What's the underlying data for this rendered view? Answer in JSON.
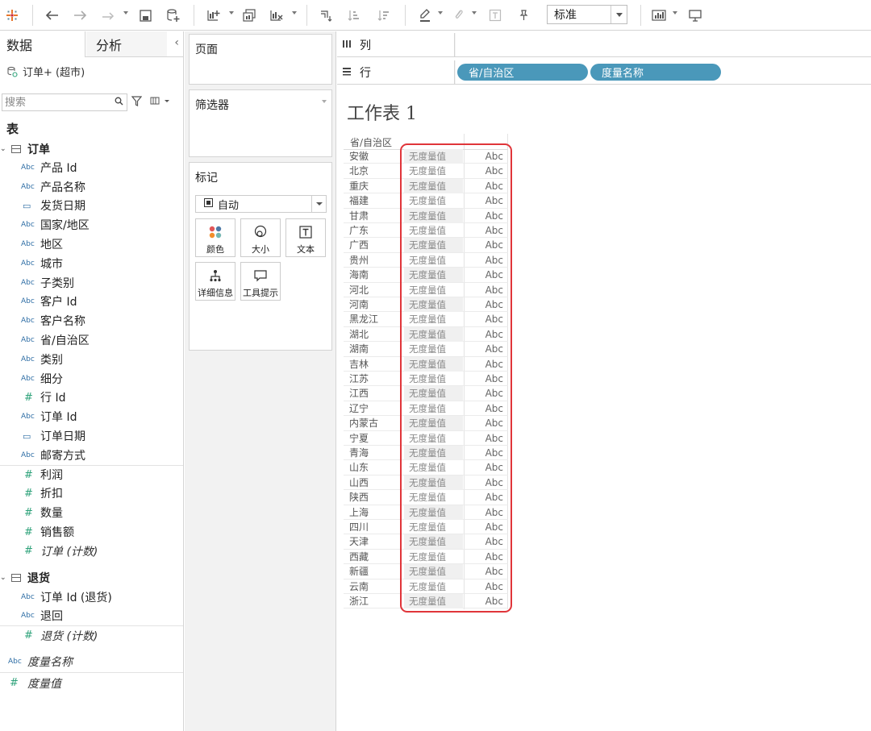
{
  "toolbar": {
    "view_size": "标准"
  },
  "left_pane": {
    "tabs": {
      "data": "数据",
      "analytics": "分析"
    },
    "datasource": "订单+ (超市)",
    "search_placeholder": "搜索",
    "tables_heading": "表",
    "tables": [
      {
        "name": "订单",
        "fields": [
          {
            "type": "Abc",
            "name": "产品 Id"
          },
          {
            "type": "Abc",
            "name": "产品名称"
          },
          {
            "type": "date",
            "name": "发货日期"
          },
          {
            "type": "Abc",
            "name": "国家/地区"
          },
          {
            "type": "Abc",
            "name": "地区"
          },
          {
            "type": "Abc",
            "name": "城市"
          },
          {
            "type": "Abc",
            "name": "子类别"
          },
          {
            "type": "Abc",
            "name": "客户 Id"
          },
          {
            "type": "Abc",
            "name": "客户名称"
          },
          {
            "type": "Abc",
            "name": "省/自治区"
          },
          {
            "type": "Abc",
            "name": "类别"
          },
          {
            "type": "Abc",
            "name": "细分"
          },
          {
            "type": "#",
            "name": "行 Id"
          },
          {
            "type": "Abc",
            "name": "订单 Id"
          },
          {
            "type": "date",
            "name": "订单日期"
          },
          {
            "type": "Abc",
            "name": "邮寄方式"
          }
        ],
        "measures": [
          {
            "type": "#",
            "name": "利润"
          },
          {
            "type": "#",
            "name": "折扣"
          },
          {
            "type": "#",
            "name": "数量"
          },
          {
            "type": "#",
            "name": "销售额"
          },
          {
            "type": "#",
            "name": "订单 (计数)",
            "italic": true
          }
        ]
      },
      {
        "name": "退货",
        "fields": [
          {
            "type": "Abc",
            "name": "订单 Id (退货)"
          },
          {
            "type": "Abc",
            "name": "退回"
          }
        ],
        "measures": [
          {
            "type": "#",
            "name": "退货 (计数)",
            "italic": true
          }
        ]
      }
    ],
    "measure_names": {
      "type": "Abc",
      "name": "度量名称"
    },
    "measure_values": {
      "type": "#",
      "name": "度量值"
    }
  },
  "middle_pane": {
    "pages": "页面",
    "filters": "筛选器",
    "marks": "标记",
    "marks_type": "自动",
    "mark_buttons": {
      "color": "颜色",
      "size": "大小",
      "text": "文本",
      "detail": "详细信息",
      "tooltip": "工具提示"
    }
  },
  "shelves": {
    "columns_label": "列",
    "rows_label": "行",
    "row_pills": [
      "省/自治区",
      "度量名称"
    ]
  },
  "sheet": {
    "title": "工作表 1",
    "header": "省/自治区",
    "measure_label": "无度量值",
    "cell_value": "Abc",
    "provinces": [
      "安徽",
      "北京",
      "重庆",
      "福建",
      "甘肃",
      "广东",
      "广西",
      "贵州",
      "海南",
      "河北",
      "河南",
      "黑龙江",
      "湖北",
      "湖南",
      "吉林",
      "江苏",
      "江西",
      "辽宁",
      "内蒙古",
      "宁夏",
      "青海",
      "山东",
      "山西",
      "陕西",
      "上海",
      "四川",
      "天津",
      "西藏",
      "新疆",
      "云南",
      "浙江"
    ]
  },
  "colors": {
    "pill": "#4a98ba",
    "highlight": "#e0353a",
    "measure_green": "#2ea27a",
    "dimension_blue": "#2f6ea5"
  }
}
